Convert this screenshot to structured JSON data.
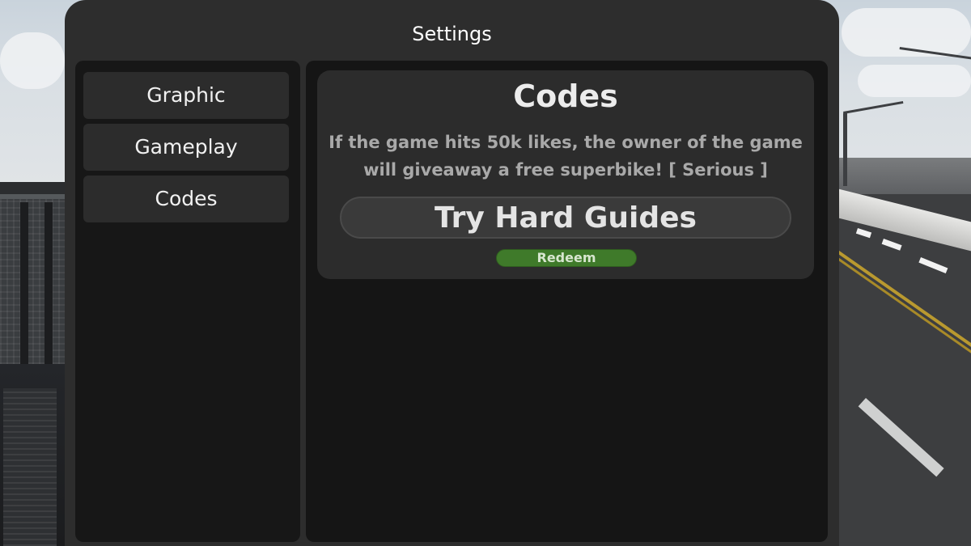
{
  "window": {
    "title": "Settings"
  },
  "sidebar": {
    "tabs": [
      {
        "label": "Graphic"
      },
      {
        "label": "Gameplay"
      },
      {
        "label": "Codes"
      }
    ]
  },
  "codes": {
    "title": "Codes",
    "description_line1": "If the game hits 50k likes, the owner of the game",
    "description_line2": "will giveaway a free superbike!  [ Serious ]",
    "input_value": "Try Hard Guides",
    "redeem_label": "Redeem"
  },
  "colors": {
    "window_bg": "#2d2d2d",
    "panel_bg": "#151515",
    "card_bg": "#2c2c2c",
    "redeem_green": "#3f7a2a"
  }
}
